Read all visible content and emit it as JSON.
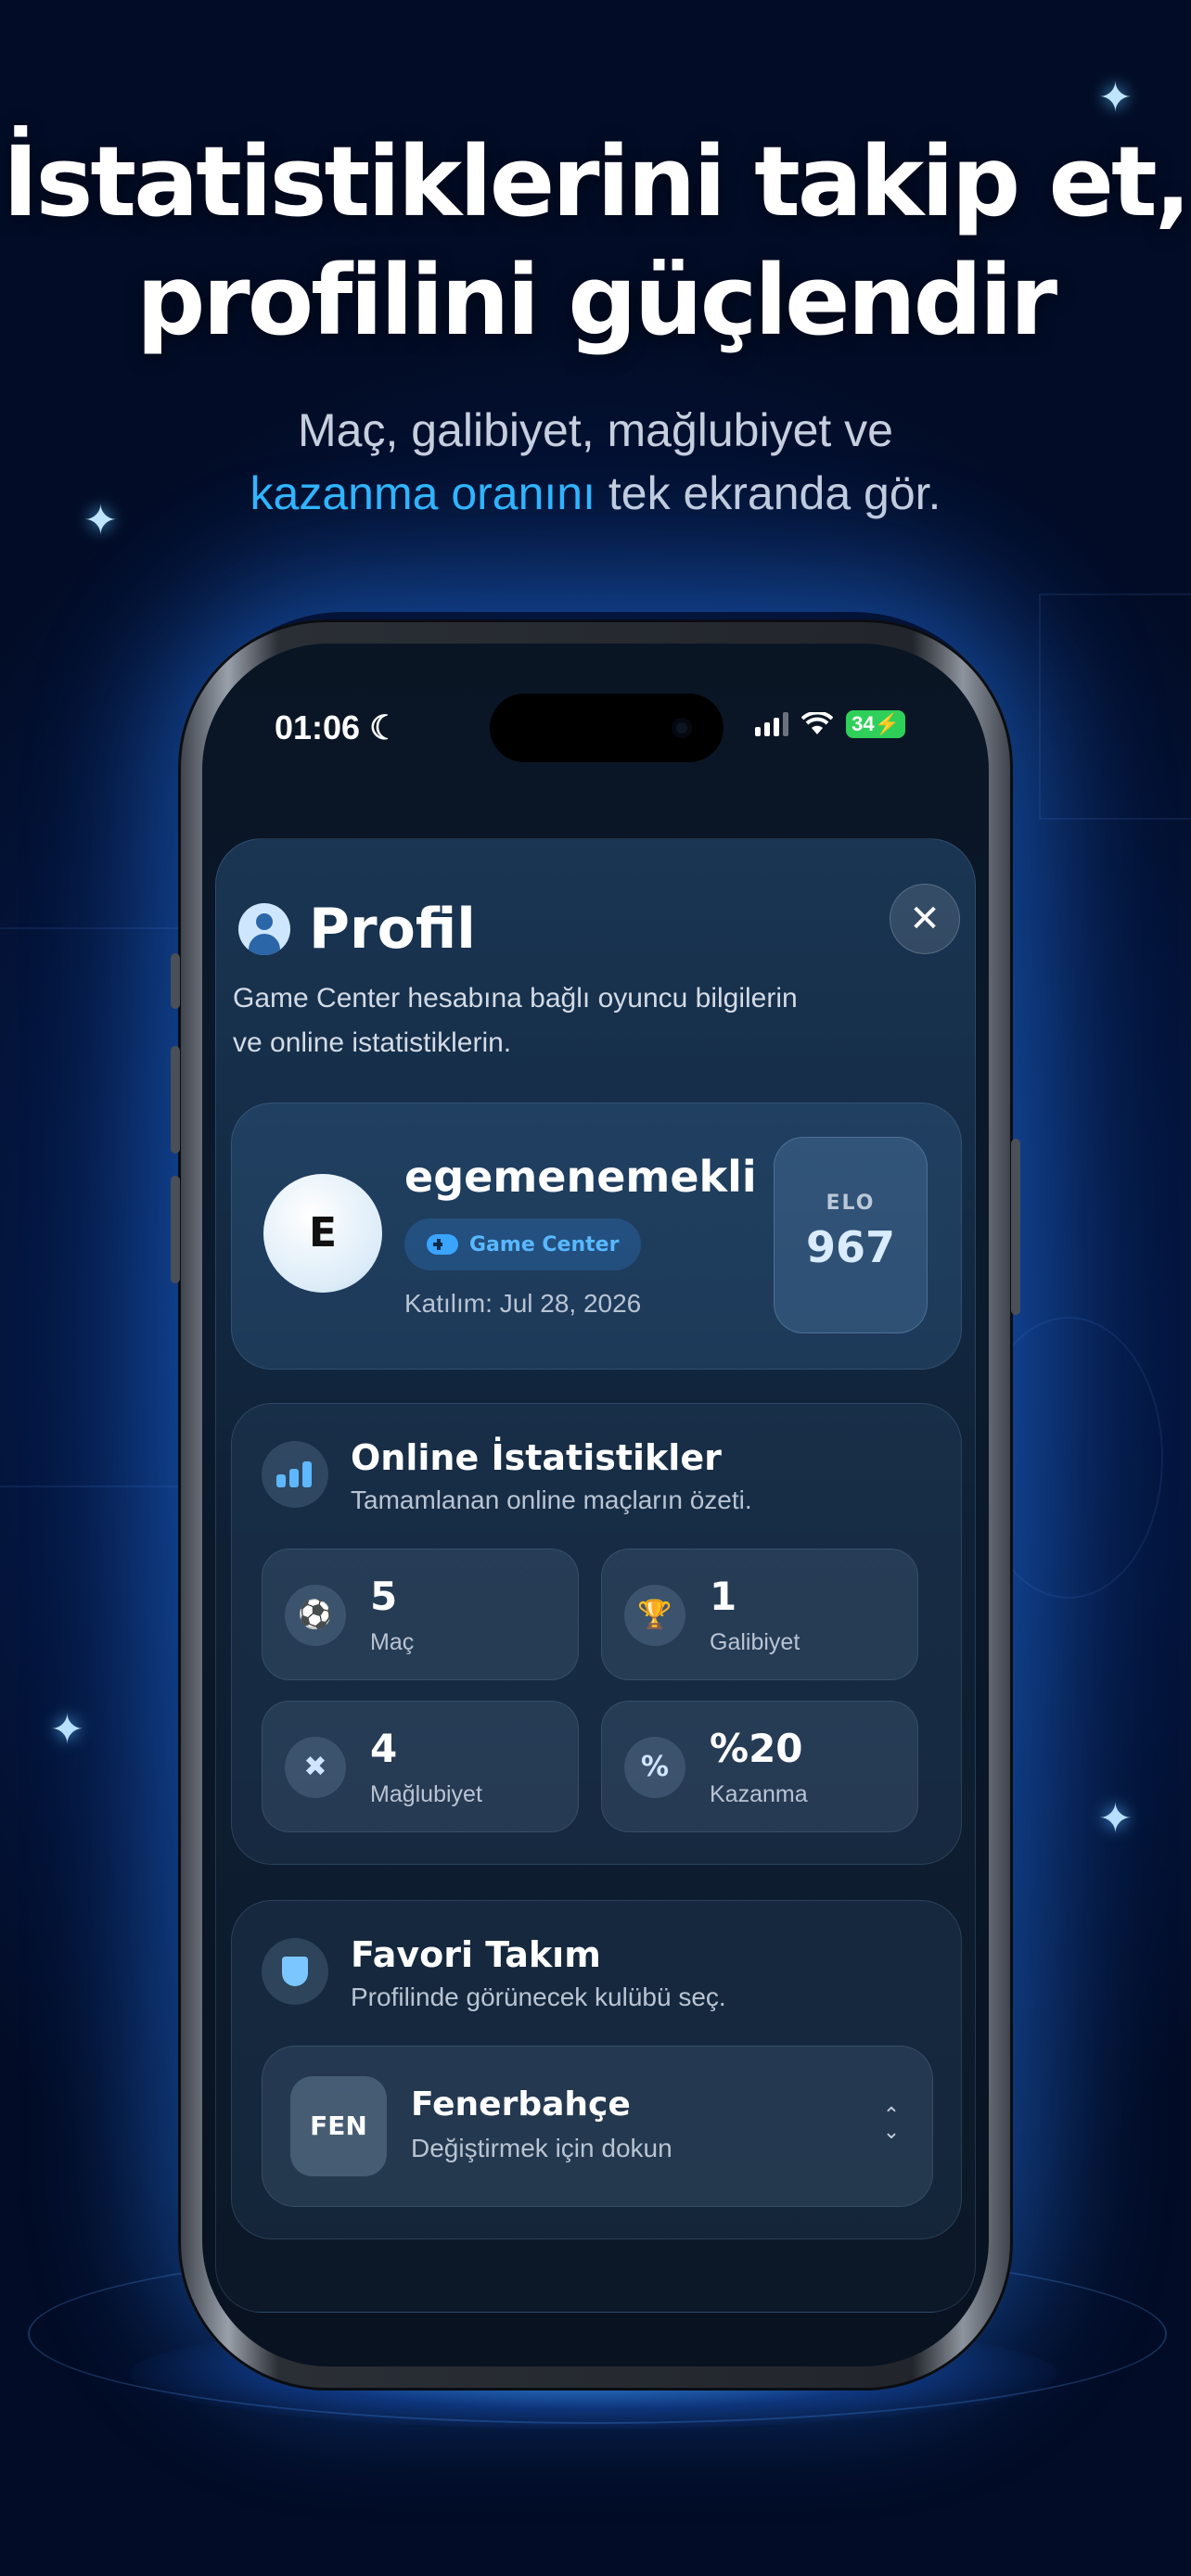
{
  "headline": {
    "line1": "İstatistiklerini takip et,",
    "line2": "profilini güçlendir"
  },
  "subheadline": {
    "line1": "Maç, galibiyet, mağlubiyet ve",
    "highlight": "kazanma oranını",
    "rest": " tek ekranda gör."
  },
  "colors": {
    "accent": "#31b7ff",
    "background": "#04163f",
    "battery": "#2fd05a"
  },
  "status_bar": {
    "time": "01:06",
    "moon_icon": "☾",
    "battery": "34"
  },
  "profile": {
    "title": "Profil",
    "close_label": "✕",
    "description": "Game Center hesabına bağlı oyuncu bilgilerin ve online istatistiklerin.",
    "avatar_letter": "E",
    "username": "egemenemekli",
    "game_center_label": "Game Center",
    "joined": "Katılım: Jul 28, 2026",
    "elo_label": "ELO",
    "elo_value": "967"
  },
  "stats": {
    "title": "Online İstatistikler",
    "subtitle": "Tamamlanan online maçların özeti.",
    "items": [
      {
        "icon": "pitch-icon",
        "glyph": "⚽",
        "value": "5",
        "label": "Maç"
      },
      {
        "icon": "trophy-icon",
        "glyph": "🏆",
        "value": "1",
        "label": "Galibiyet"
      },
      {
        "icon": "x-shield-icon",
        "glyph": "✖",
        "value": "4",
        "label": "Mağlubiyet"
      },
      {
        "icon": "percent-icon",
        "glyph": "%",
        "value": "%20",
        "label": "Kazanma"
      }
    ]
  },
  "favorite": {
    "title": "Favori Takım",
    "subtitle": "Profilinde görünecek kulübü seç.",
    "team_badge": "FEN",
    "team_name": "Fenerbahçe",
    "team_hint": "Değiştirmek için dokun",
    "chevron": "⌃⌄"
  }
}
